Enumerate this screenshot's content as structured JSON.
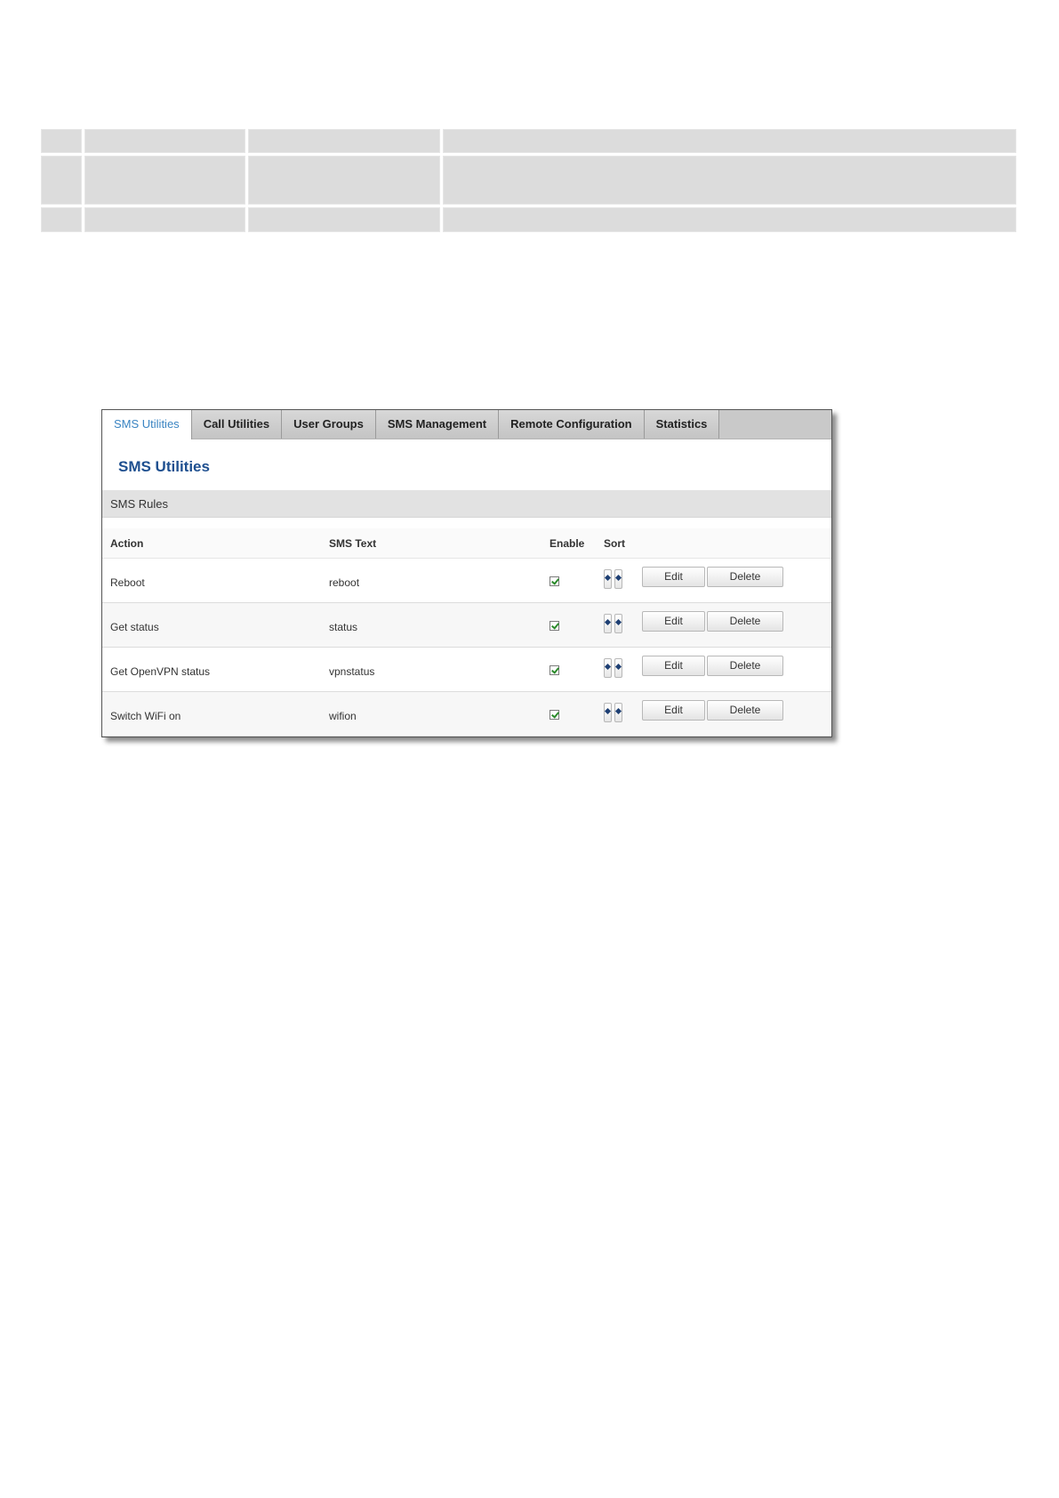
{
  "tabs": [
    {
      "label": "SMS Utilities",
      "active": true
    },
    {
      "label": "Call Utilities",
      "active": false
    },
    {
      "label": "User Groups",
      "active": false
    },
    {
      "label": "SMS Management",
      "active": false
    },
    {
      "label": "Remote Configuration",
      "active": false
    },
    {
      "label": "Statistics",
      "active": false
    }
  ],
  "page_title": "SMS Utilities",
  "section_title": "SMS Rules",
  "table": {
    "headers": {
      "action": "Action",
      "sms_text": "SMS Text",
      "enable": "Enable",
      "sort": "Sort"
    },
    "rows": [
      {
        "action": "Reboot",
        "sms_text": "reboot",
        "enabled": true
      },
      {
        "action": "Get status",
        "sms_text": "status",
        "enabled": true
      },
      {
        "action": "Get OpenVPN status",
        "sms_text": "vpnstatus",
        "enabled": true
      },
      {
        "action": "Switch WiFi on",
        "sms_text": "wifion",
        "enabled": true
      }
    ],
    "edit_label": "Edit",
    "delete_label": "Delete"
  },
  "colors": {
    "active_tab_text": "#3a84c2",
    "title_text": "#1e4f8f",
    "checkmark": "#2a8a2a",
    "sort_arrow": "#1e3f73"
  },
  "icons": {
    "enable": "checkbox-checked-icon",
    "sort_up": "arrow-up-icon",
    "sort_down": "arrow-down-icon"
  }
}
